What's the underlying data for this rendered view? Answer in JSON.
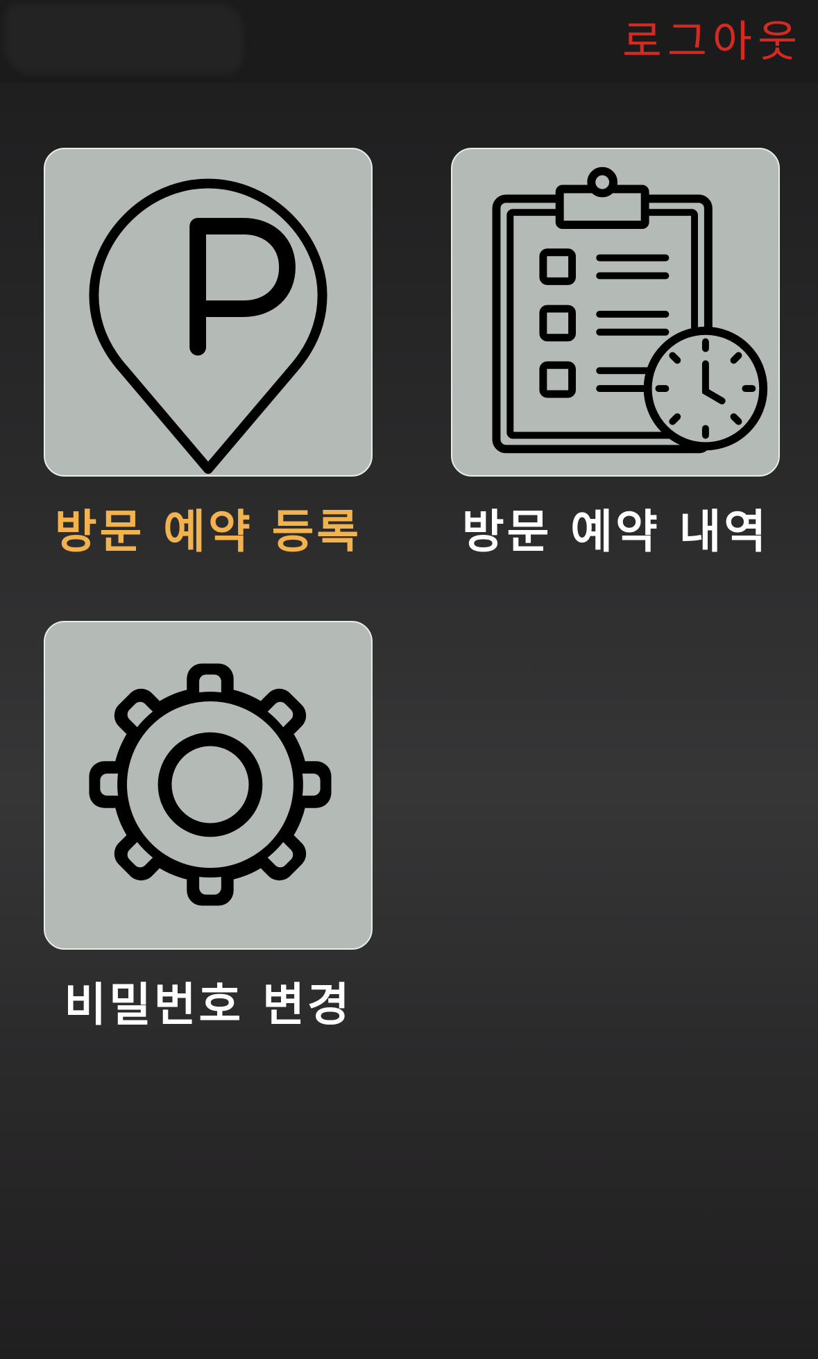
{
  "header": {
    "logout_label": "로그아웃",
    "logout_color": "#d52a22"
  },
  "menu": {
    "tiles": [
      {
        "label": "방문 예약 등록",
        "icon": "parking-location-icon",
        "selected": true
      },
      {
        "label": "방문 예약 내역",
        "icon": "clipboard-clock-icon",
        "selected": false
      },
      {
        "label": "비밀번호 변경",
        "icon": "gear-icon",
        "selected": false
      }
    ],
    "selected_label_color": "#f2b24d",
    "label_color": "#ffffff",
    "tile_background": "#b4bbb6"
  }
}
